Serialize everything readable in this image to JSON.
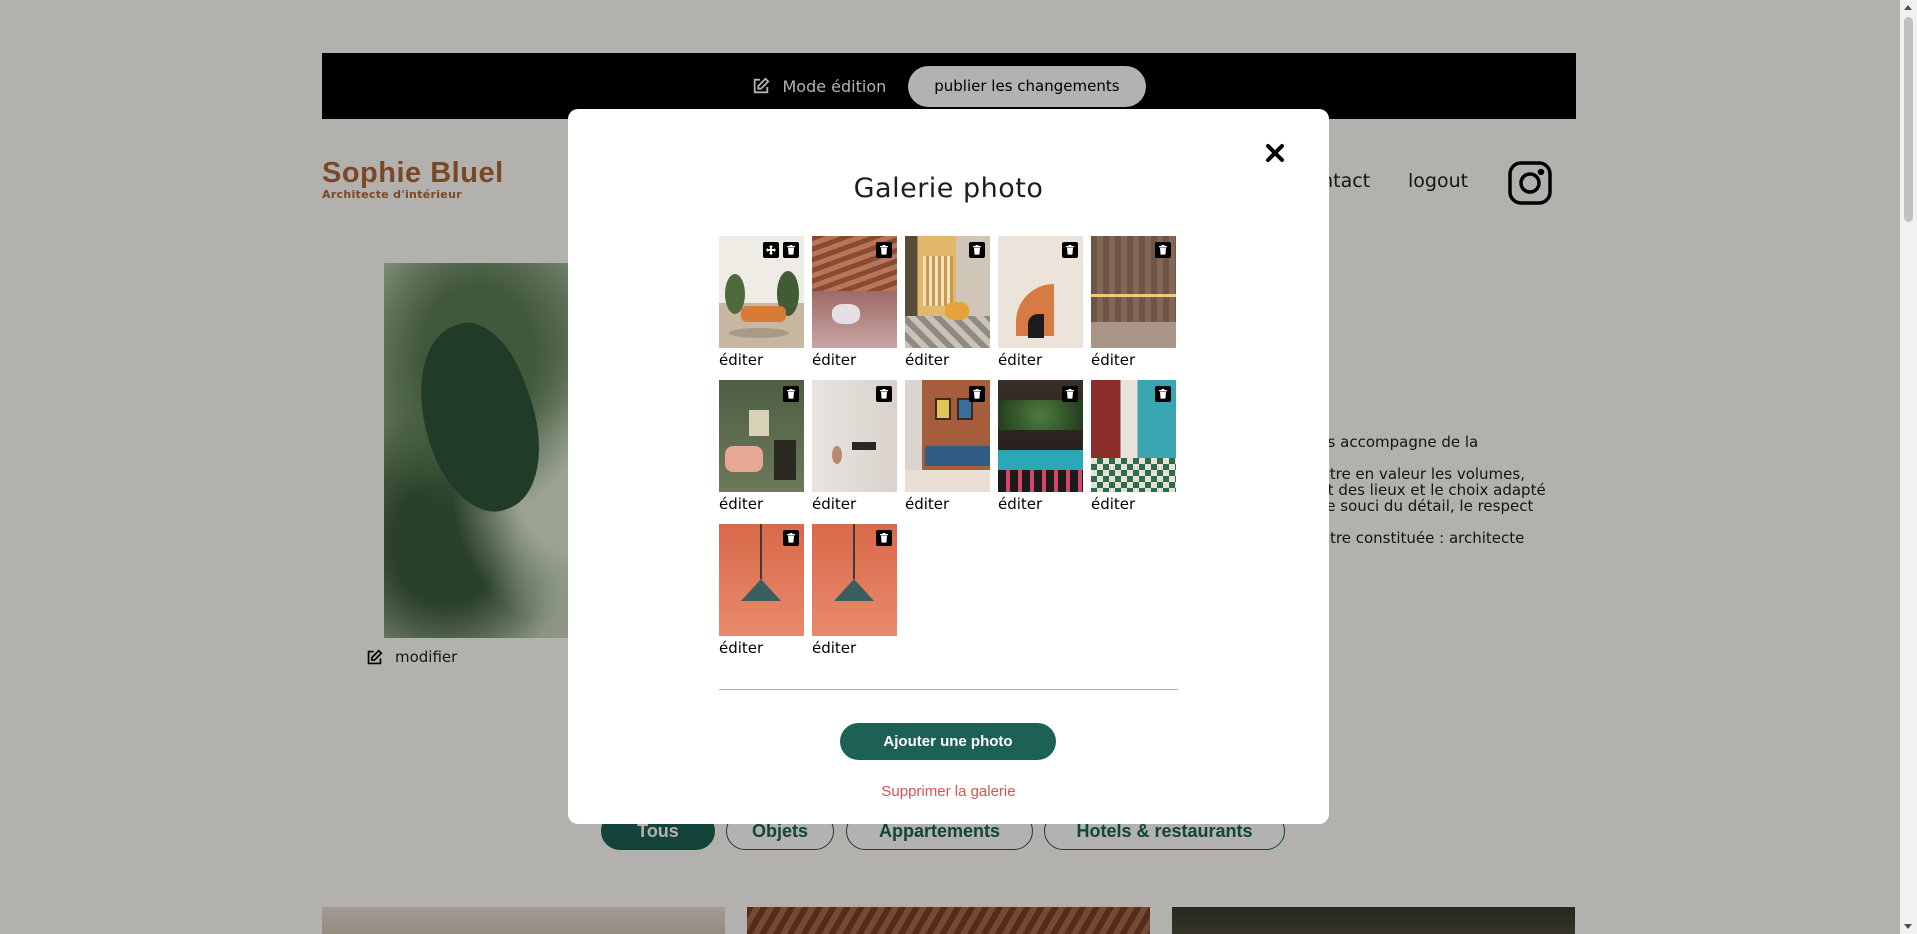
{
  "edit_bar": {
    "mode_label": "Mode édition",
    "publish_label": "publier les changements"
  },
  "header": {
    "logo_title": "Sophie Bluel",
    "logo_subtitle": "Architecte d'intérieur",
    "nav": {
      "contact": "contact",
      "logout": "logout"
    }
  },
  "introduction": {
    "modify_label": "modifier",
    "text_lines": [
      "vous accompagne de la",
      "mettre en valeur les volumes,\nsprit des lieux et le choix adapté\nns le souci du détail, le respect",
      "ut-être constituée : architecte"
    ]
  },
  "filters": [
    "Tous",
    "Objets",
    "Appartements",
    "Hotels & restaurants"
  ],
  "modal": {
    "title": "Galerie photo",
    "edit_label": "éditer",
    "add_button": "Ajouter une photo",
    "delete_gallery": "Supprimer la galerie",
    "photos": [
      {
        "icon": "trash-icon",
        "move": true
      },
      {
        "icon": "trash-icon"
      },
      {
        "icon": "trash-icon"
      },
      {
        "icon": "trash-icon"
      },
      {
        "icon": "trash-icon"
      },
      {
        "icon": "trash-icon"
      },
      {
        "icon": "trash-icon"
      },
      {
        "icon": "trash-icon"
      },
      {
        "icon": "trash-icon"
      },
      {
        "icon": "trash-icon"
      },
      {
        "icon": "trash-icon"
      },
      {
        "icon": "trash-icon"
      }
    ]
  },
  "colors": {
    "brand": "#b1663c",
    "accent": "#1d6154",
    "danger": "#d65353"
  }
}
